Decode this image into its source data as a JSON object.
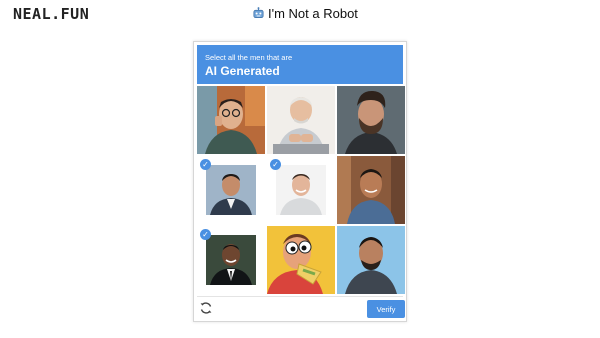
{
  "site": {
    "logo": "NEAL.FUN"
  },
  "page": {
    "title": "I'm Not a Robot",
    "title_icon": "robot-icon"
  },
  "captcha": {
    "instruction": "Select all the men that are",
    "target": "AI Generated",
    "tiles": [
      {
        "name": "tile-man-glasses",
        "selected": false
      },
      {
        "name": "tile-older-man-laptop",
        "selected": false
      },
      {
        "name": "tile-bearded-man",
        "selected": false
      },
      {
        "name": "tile-man-suit",
        "selected": true
      },
      {
        "name": "tile-smiling-man",
        "selected": true
      },
      {
        "name": "tile-man-denim",
        "selected": false
      },
      {
        "name": "tile-man-dark-suit",
        "selected": true
      },
      {
        "name": "tile-cartoon-eyes-man",
        "selected": false
      },
      {
        "name": "tile-man-blue-sky",
        "selected": false
      }
    ],
    "verify_label": "Verify",
    "reload_icon": "reload-icon",
    "check_glyph": "✓",
    "accent": "#4a90e2"
  }
}
